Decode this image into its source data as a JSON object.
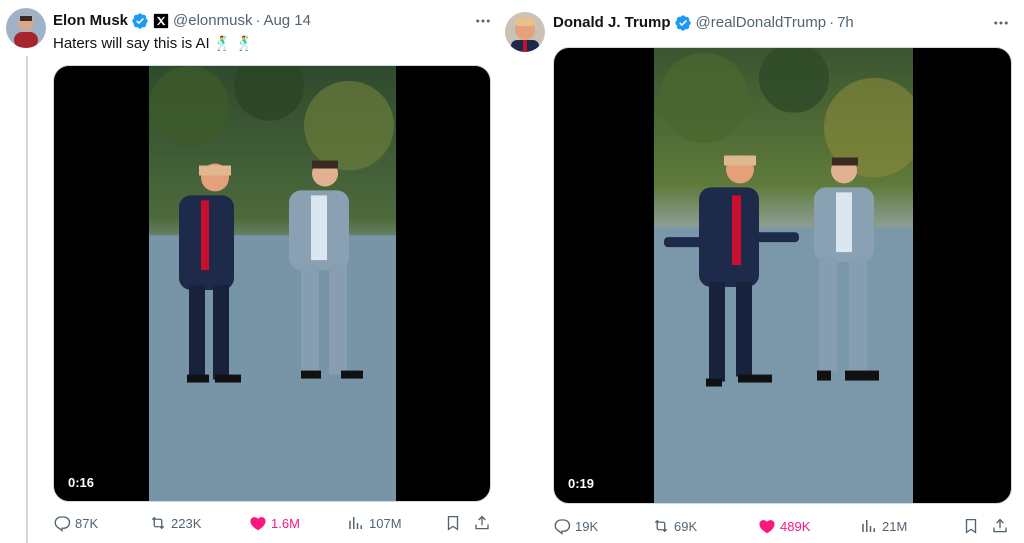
{
  "tweets": [
    {
      "author_name": "Elon Musk",
      "verified_icon": "verified-badge-icon",
      "affiliate_icon": "x-logo-icon",
      "handle": "@elonmusk",
      "separator": "·",
      "time": "Aug 14",
      "text": "Haters will say this is AI",
      "emojis": "🕺 🕺",
      "video_duration": "0:16",
      "replies": "87K",
      "reposts": "223K",
      "likes": "1.6M",
      "views": "107M"
    },
    {
      "author_name": "Donald J. Trump",
      "verified_icon": "verified-badge-icon",
      "handle": "@realDonaldTrump",
      "separator": "·",
      "time": "7h",
      "video_duration": "0:19",
      "replies": "19K",
      "reposts": "69K",
      "likes": "489K",
      "views": "21M"
    }
  ],
  "colors": {
    "verified": "#1d9bf0",
    "like": "#f91880",
    "muted": "#536471",
    "text": "#0f1419"
  }
}
